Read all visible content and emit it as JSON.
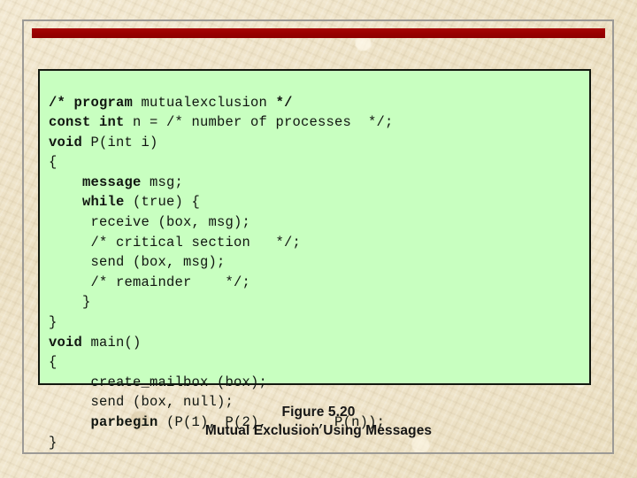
{
  "slide": {
    "background_color": "#ede1c6",
    "frame_border_color": "#9c9a96",
    "accent_bar_color": "#9e0000"
  },
  "code_box": {
    "background_color": "#c8ffc0",
    "border_color": "#12180f",
    "language": "c",
    "lines": [
      [
        {
          "t": "/* ",
          "b": true
        },
        {
          "t": "program ",
          "b": true
        },
        {
          "t": "mutualexclusion ",
          "b": false
        },
        {
          "t": "*/",
          "b": true
        }
      ],
      [
        {
          "t": "const int ",
          "b": true
        },
        {
          "t": "n = /* number of processes  */;",
          "b": false
        }
      ],
      [
        {
          "t": "void ",
          "b": true
        },
        {
          "t": "P(int i)",
          "b": false
        }
      ],
      [
        {
          "t": "{",
          "b": false
        }
      ],
      [
        {
          "t": "    ",
          "b": false
        },
        {
          "t": "message ",
          "b": true
        },
        {
          "t": "msg;",
          "b": false
        }
      ],
      [
        {
          "t": "    ",
          "b": false
        },
        {
          "t": "while ",
          "b": true
        },
        {
          "t": "(true) {",
          "b": false
        }
      ],
      [
        {
          "t": "     receive (box, msg);",
          "b": false
        }
      ],
      [
        {
          "t": "     /* critical section   */;",
          "b": false
        }
      ],
      [
        {
          "t": "     send (box, msg);",
          "b": false
        }
      ],
      [
        {
          "t": "     /* remainder    */;",
          "b": false
        }
      ],
      [
        {
          "t": "    }",
          "b": false
        }
      ],
      [
        {
          "t": "}",
          "b": false
        }
      ],
      [
        {
          "t": "void ",
          "b": true
        },
        {
          "t": "main()",
          "b": false
        }
      ],
      [
        {
          "t": "{",
          "b": false
        }
      ],
      [
        {
          "t": "     create_mailbox (box);",
          "b": false
        }
      ],
      [
        {
          "t": "     send (box, null);",
          "b": false
        }
      ],
      [
        {
          "t": "     ",
          "b": false
        },
        {
          "t": "parbegin ",
          "b": true
        },
        {
          "t": "(P(1), P(2), . . ., P(n));",
          "b": false
        }
      ],
      [
        {
          "t": "}",
          "b": false
        }
      ]
    ]
  },
  "caption": {
    "figure_number": "Figure 5.20",
    "figure_title": "Mutual Exclusion Using Messages"
  }
}
